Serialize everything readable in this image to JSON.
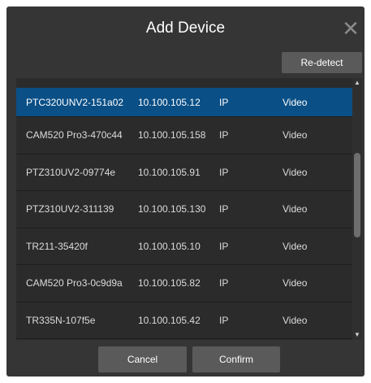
{
  "dialog": {
    "title": "Add Device",
    "close_icon": "close-icon",
    "redetect_label": "Re-detect",
    "cancel_label": "Cancel",
    "confirm_label": "Confirm"
  },
  "devices": [
    {
      "name": "PTC320UNV2-151a02",
      "ip": "10.100.105.12",
      "protocol": "IP",
      "function": "Video",
      "selected": true
    },
    {
      "name": "CAM520 Pro3-470c44",
      "ip": "10.100.105.158",
      "protocol": "IP",
      "function": "Video"
    },
    {
      "name": "PTZ310UV2-09774e",
      "ip": "10.100.105.91",
      "protocol": "IP",
      "function": "Video"
    },
    {
      "name": "PTZ310UV2-311139",
      "ip": "10.100.105.130",
      "protocol": "IP",
      "function": "Video"
    },
    {
      "name": "TR211-35420f",
      "ip": "10.100.105.10",
      "protocol": "IP",
      "function": "Video"
    },
    {
      "name": "CAM520 Pro3-0c9d9a",
      "ip": "10.100.105.82",
      "protocol": "IP",
      "function": "Video"
    },
    {
      "name": "TR335N-107f5e",
      "ip": "10.100.105.42",
      "protocol": "IP",
      "function": "Video"
    }
  ],
  "colors": {
    "dialog_bg": "#353535",
    "list_bg": "#2b2b2b",
    "selected_row": "#0a4f86",
    "button_bg": "#5a5a5a"
  }
}
